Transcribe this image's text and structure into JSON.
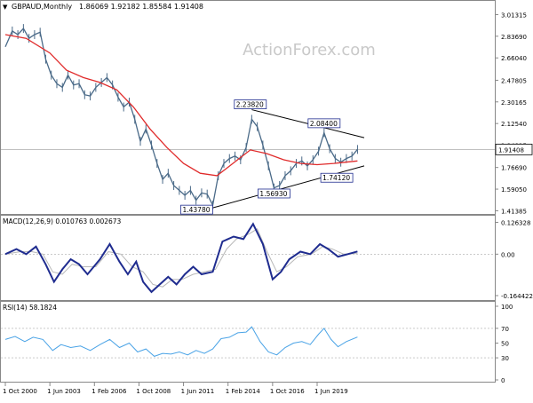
{
  "header": {
    "symbol": "GBPAUD,Monthly",
    "ohlc": "1.86069 1.92182 1.85584 1.91408"
  },
  "watermark": "ActionForex.com",
  "colors": {
    "price": "#4a6a88",
    "ma": "#e02b2b",
    "trend": "#000000",
    "macd": "#1f2c8f",
    "signal": "#b8b8b8",
    "rsi": "#4aa3e6",
    "label_border": "#1f2c8f"
  },
  "chart_data": [
    {
      "type": "line",
      "title": "GBPAUD,Monthly",
      "ylim": [
        1.41,
        3.06
      ],
      "y_ticks": [
        "3.01315",
        "2.83690",
        "2.66040",
        "2.47805",
        "2.30165",
        "2.12540",
        "1.94915",
        "1.76690",
        "1.59050",
        "1.41385"
      ],
      "current_price_label": "1.91408",
      "current_price": 1.91408,
      "x_ticks": [
        "1 Oct 2000",
        "1 Jun 2003",
        "1 Feb 2006",
        "1 Oct 2008",
        "1 Jun 2011",
        "1 Feb 2014",
        "1 Oct 2016",
        "1 Jun 2019"
      ],
      "series": [
        {
          "name": "close",
          "points": [
            [
              "2000-10",
              2.75
            ],
            [
              "2001-03",
              2.88
            ],
            [
              "2001-07",
              2.85
            ],
            [
              "2001-11",
              2.9
            ],
            [
              "2002-03",
              2.82
            ],
            [
              "2002-07",
              2.85
            ],
            [
              "2002-11",
              2.87
            ],
            [
              "2003-03",
              2.65
            ],
            [
              "2003-07",
              2.52
            ],
            [
              "2003-11",
              2.45
            ],
            [
              "2004-03",
              2.42
            ],
            [
              "2004-07",
              2.52
            ],
            [
              "2004-11",
              2.44
            ],
            [
              "2005-03",
              2.45
            ],
            [
              "2005-07",
              2.36
            ],
            [
              "2005-11",
              2.35
            ],
            [
              "2006-03",
              2.42
            ],
            [
              "2006-07",
              2.46
            ],
            [
              "2006-11",
              2.5
            ],
            [
              "2007-03",
              2.44
            ],
            [
              "2007-07",
              2.34
            ],
            [
              "2007-11",
              2.26
            ],
            [
              "2008-03",
              2.3
            ],
            [
              "2008-07",
              2.16
            ],
            [
              "2008-11",
              1.98
            ],
            [
              "2009-03",
              2.08
            ],
            [
              "2009-07",
              1.95
            ],
            [
              "2009-11",
              1.8
            ],
            [
              "2010-03",
              1.67
            ],
            [
              "2010-07",
              1.72
            ],
            [
              "2010-11",
              1.62
            ],
            [
              "2011-03",
              1.58
            ],
            [
              "2011-07",
              1.54
            ],
            [
              "2011-11",
              1.58
            ],
            [
              "2012-03",
              1.5
            ],
            [
              "2012-07",
              1.56
            ],
            [
              "2012-11",
              1.55
            ],
            [
              "2013-03",
              1.46
            ],
            [
              "2013-07",
              1.7
            ],
            [
              "2013-11",
              1.8
            ],
            [
              "2014-03",
              1.84
            ],
            [
              "2014-07",
              1.86
            ],
            [
              "2014-11",
              1.83
            ],
            [
              "2015-03",
              1.93
            ],
            [
              "2015-07",
              2.16
            ],
            [
              "2015-11",
              2.1
            ],
            [
              "2016-03",
              1.95
            ],
            [
              "2016-07",
              1.78
            ],
            [
              "2016-11",
              1.6
            ],
            [
              "2017-03",
              1.62
            ],
            [
              "2017-07",
              1.7
            ],
            [
              "2017-11",
              1.74
            ],
            [
              "2018-03",
              1.8
            ],
            [
              "2018-07",
              1.82
            ],
            [
              "2018-11",
              1.78
            ],
            [
              "2019-03",
              1.83
            ],
            [
              "2019-07",
              1.9
            ],
            [
              "2019-11",
              2.05
            ],
            [
              "2020-03",
              1.92
            ],
            [
              "2020-07",
              1.84
            ],
            [
              "2020-11",
              1.81
            ],
            [
              "2021-03",
              1.84
            ],
            [
              "2021-07",
              1.86
            ],
            [
              "2021-11",
              1.91408
            ]
          ]
        },
        {
          "name": "moving-average",
          "points": [
            [
              "2000-10",
              2.85
            ],
            [
              "2002-01",
              2.82
            ],
            [
              "2003-06",
              2.7
            ],
            [
              "2004-06",
              2.56
            ],
            [
              "2005-06",
              2.5
            ],
            [
              "2006-06",
              2.46
            ],
            [
              "2007-06",
              2.4
            ],
            [
              "2008-06",
              2.26
            ],
            [
              "2009-06",
              2.08
            ],
            [
              "2010-06",
              1.93
            ],
            [
              "2011-06",
              1.8
            ],
            [
              "2012-06",
              1.72
            ],
            [
              "2013-06",
              1.7
            ],
            [
              "2014-01",
              1.76
            ],
            [
              "2014-10",
              1.84
            ],
            [
              "2015-06",
              1.91
            ],
            [
              "2016-06",
              1.88
            ],
            [
              "2017-06",
              1.83
            ],
            [
              "2018-06",
              1.8
            ],
            [
              "2019-06",
              1.79
            ],
            [
              "2020-06",
              1.8
            ],
            [
              "2021-11",
              1.82
            ]
          ]
        }
      ],
      "trendlines": [
        {
          "from": [
            "2015-07",
            2.2382
          ],
          "to": [
            "2022-06",
            2.01
          ]
        },
        {
          "from": [
            "2013-03",
            1.4378
          ],
          "to": [
            "2022-06",
            1.78
          ]
        }
      ],
      "annotations": [
        {
          "x": "2015-06",
          "y": 2.2382,
          "label": "2.23820"
        },
        {
          "x": "2019-11",
          "y": 2.084,
          "label": "2.08400"
        },
        {
          "x": "2016-11",
          "y": 1.5693,
          "label": "1.56930"
        },
        {
          "x": "2020-03",
          "y": 1.7412,
          "label": "1.74120"
        },
        {
          "x": "2013-03",
          "y": 1.4378,
          "label": "1.43780"
        }
      ]
    },
    {
      "type": "line",
      "title": "MACD(12,26,9) 0.010763 0.002673",
      "ylim": [
        -0.175,
        0.135
      ],
      "y_ticks": [
        "0.126328",
        "0.00",
        "-0.164422"
      ],
      "series": [
        {
          "name": "MACD",
          "points": [
            [
              "2000-10",
              0.0
            ],
            [
              "2001-06",
              0.02
            ],
            [
              "2002-01",
              0.0
            ],
            [
              "2002-08",
              0.03
            ],
            [
              "2003-03",
              -0.04
            ],
            [
              "2003-09",
              -0.11
            ],
            [
              "2004-03",
              -0.06
            ],
            [
              "2004-09",
              -0.02
            ],
            [
              "2005-03",
              -0.04
            ],
            [
              "2005-09",
              -0.08
            ],
            [
              "2006-06",
              -0.02
            ],
            [
              "2007-01",
              0.04
            ],
            [
              "2007-08",
              -0.03
            ],
            [
              "2008-02",
              -0.08
            ],
            [
              "2008-08",
              -0.03
            ],
            [
              "2009-01",
              -0.11
            ],
            [
              "2009-07",
              -0.15
            ],
            [
              "2010-01",
              -0.12
            ],
            [
              "2010-07",
              -0.09
            ],
            [
              "2011-01",
              -0.12
            ],
            [
              "2011-07",
              -0.08
            ],
            [
              "2012-01",
              -0.05
            ],
            [
              "2012-07",
              -0.08
            ],
            [
              "2013-03",
              -0.07
            ],
            [
              "2013-10",
              0.05
            ],
            [
              "2014-06",
              0.07
            ],
            [
              "2015-01",
              0.06
            ],
            [
              "2015-08",
              0.12
            ],
            [
              "2016-03",
              0.04
            ],
            [
              "2016-10",
              -0.1
            ],
            [
              "2017-04",
              -0.07
            ],
            [
              "2017-10",
              -0.02
            ],
            [
              "2018-06",
              0.01
            ],
            [
              "2019-01",
              0.0
            ],
            [
              "2019-08",
              0.04
            ],
            [
              "2020-02",
              0.02
            ],
            [
              "2020-09",
              -0.01
            ],
            [
              "2021-04",
              0.0
            ],
            [
              "2021-11",
              0.010763
            ]
          ]
        },
        {
          "name": "signal",
          "points": [
            [
              "2000-10",
              0.0
            ],
            [
              "2001-09",
              0.01
            ],
            [
              "2002-05",
              0.01
            ],
            [
              "2003-01",
              0.0
            ],
            [
              "2003-08",
              -0.07
            ],
            [
              "2004-03",
              -0.08
            ],
            [
              "2004-10",
              -0.04
            ],
            [
              "2005-06",
              -0.05
            ],
            [
              "2006-03",
              -0.05
            ],
            [
              "2006-12",
              0.01
            ],
            [
              "2007-09",
              0.0
            ],
            [
              "2008-05",
              -0.05
            ],
            [
              "2009-01",
              -0.07
            ],
            [
              "2009-08",
              -0.12
            ],
            [
              "2010-03",
              -0.13
            ],
            [
              "2010-10",
              -0.1
            ],
            [
              "2011-05",
              -0.1
            ],
            [
              "2012-01",
              -0.08
            ],
            [
              "2012-09",
              -0.07
            ],
            [
              "2013-05",
              -0.06
            ],
            [
              "2014-01",
              0.02
            ],
            [
              "2014-08",
              0.06
            ],
            [
              "2015-05",
              0.08
            ],
            [
              "2015-11",
              0.1
            ],
            [
              "2016-06",
              0.01
            ],
            [
              "2017-01",
              -0.07
            ],
            [
              "2017-08",
              -0.05
            ],
            [
              "2018-04",
              -0.01
            ],
            [
              "2019-02",
              0.0
            ],
            [
              "2019-10",
              0.03
            ],
            [
              "2020-05",
              0.02
            ],
            [
              "2021-01",
              0.0
            ],
            [
              "2021-11",
              0.002673
            ]
          ]
        }
      ]
    },
    {
      "type": "line",
      "title": "RSI(14) 58.1824",
      "ylim": [
        0,
        100
      ],
      "y_ticks": [
        "100",
        "70",
        "50",
        "30",
        "0"
      ],
      "series": [
        {
          "name": "RSI",
          "points": [
            [
              "2000-10",
              55
            ],
            [
              "2001-05",
              59
            ],
            [
              "2001-12",
              52
            ],
            [
              "2002-06",
              58
            ],
            [
              "2003-01",
              55
            ],
            [
              "2003-08",
              40
            ],
            [
              "2004-02",
              48
            ],
            [
              "2004-09",
              44
            ],
            [
              "2005-04",
              46
            ],
            [
              "2005-11",
              40
            ],
            [
              "2006-06",
              48
            ],
            [
              "2007-01",
              55
            ],
            [
              "2007-08",
              44
            ],
            [
              "2008-03",
              50
            ],
            [
              "2008-09",
              38
            ],
            [
              "2009-03",
              42
            ],
            [
              "2009-09",
              32
            ],
            [
              "2010-03",
              36
            ],
            [
              "2010-09",
              35
            ],
            [
              "2011-03",
              38
            ],
            [
              "2011-09",
              34
            ],
            [
              "2012-03",
              40
            ],
            [
              "2012-09",
              36
            ],
            [
              "2013-03",
              42
            ],
            [
              "2013-09",
              56
            ],
            [
              "2014-03",
              58
            ],
            [
              "2014-09",
              64
            ],
            [
              "2015-03",
              65
            ],
            [
              "2015-07",
              72
            ],
            [
              "2016-01",
              52
            ],
            [
              "2016-07",
              38
            ],
            [
              "2017-01",
              34
            ],
            [
              "2017-07",
              44
            ],
            [
              "2018-01",
              50
            ],
            [
              "2018-07",
              52
            ],
            [
              "2019-01",
              48
            ],
            [
              "2019-07",
              62
            ],
            [
              "2019-11",
              70
            ],
            [
              "2020-04",
              55
            ],
            [
              "2020-09",
              45
            ],
            [
              "2021-03",
              52
            ],
            [
              "2021-11",
              58.1824
            ]
          ]
        }
      ]
    }
  ]
}
